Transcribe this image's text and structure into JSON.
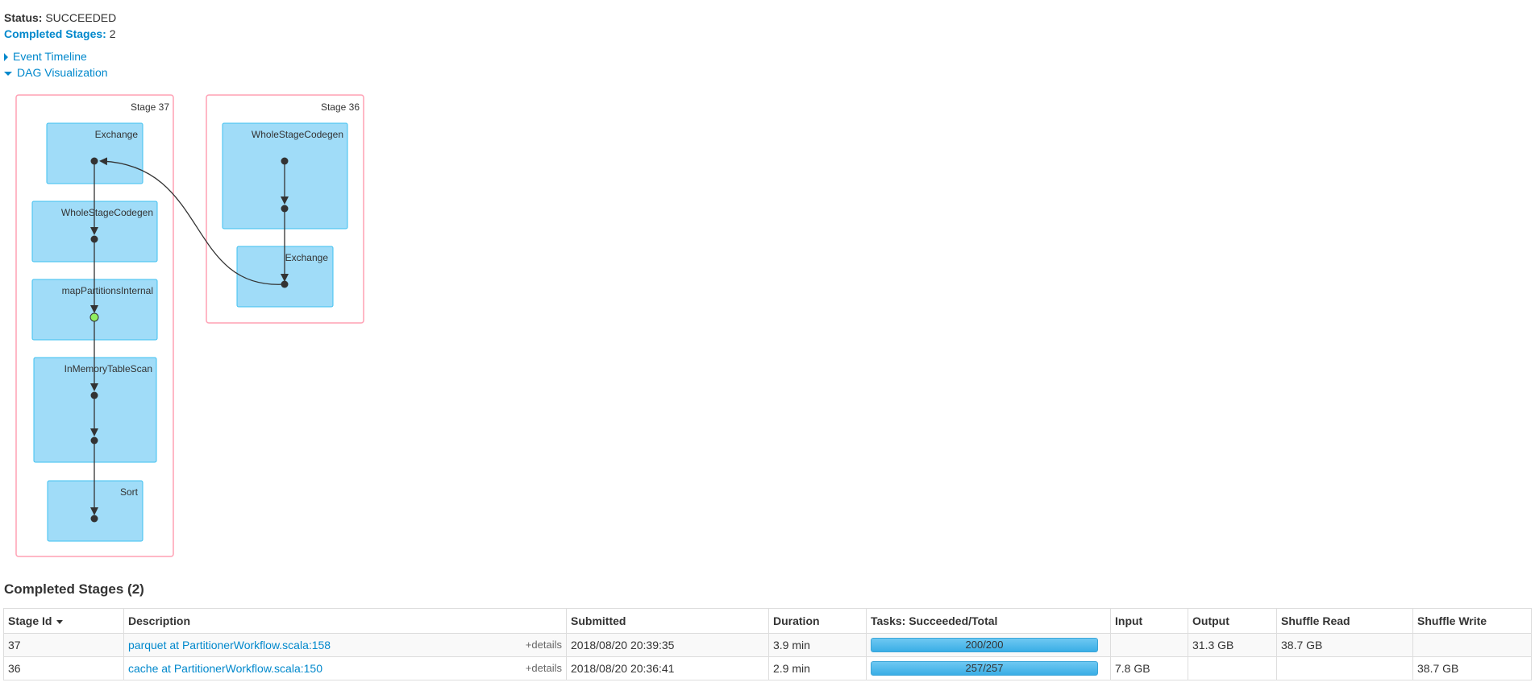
{
  "summary": {
    "status_label": "Status:",
    "status_value": "SUCCEEDED",
    "completed_label": "Completed Stages:",
    "completed_value": "2"
  },
  "toggles": {
    "event_timeline": "Event Timeline",
    "dag_visualization": "DAG Visualization"
  },
  "dag": {
    "stages": [
      {
        "title": "Stage 37",
        "clusters": [
          "Exchange",
          "WholeStageCodegen",
          "mapPartitionsInternal",
          "InMemoryTableScan",
          "Sort"
        ]
      },
      {
        "title": "Stage 36",
        "clusters": [
          "WholeStageCodegen",
          "Exchange"
        ]
      }
    ]
  },
  "completed_section": {
    "title": "Completed Stages (2)",
    "columns": [
      "Stage Id",
      "Description",
      "Submitted",
      "Duration",
      "Tasks: Succeeded/Total",
      "Input",
      "Output",
      "Shuffle Read",
      "Shuffle Write"
    ],
    "details_label": "+details",
    "rows": [
      {
        "stage_id": "37",
        "description": "parquet at PartitionerWorkflow.scala:158",
        "submitted": "2018/08/20 20:39:35",
        "duration": "3.9 min",
        "tasks": "200/200",
        "tasks_fraction": 1.0,
        "input": "",
        "output": "31.3 GB",
        "shuffle_read": "38.7 GB",
        "shuffle_write": ""
      },
      {
        "stage_id": "36",
        "description": "cache at PartitionerWorkflow.scala:150",
        "submitted": "2018/08/20 20:36:41",
        "duration": "2.9 min",
        "tasks": "257/257",
        "tasks_fraction": 1.0,
        "input": "7.8 GB",
        "output": "",
        "shuffle_read": "",
        "shuffle_write": "38.7 GB"
      }
    ]
  },
  "colors": {
    "link": "#0088cc",
    "stage_border": "#ffa0b4",
    "cluster_fill": "#a0dcf8",
    "cluster_stroke": "#3ec0f0",
    "node_cached": "#90ee60"
  }
}
